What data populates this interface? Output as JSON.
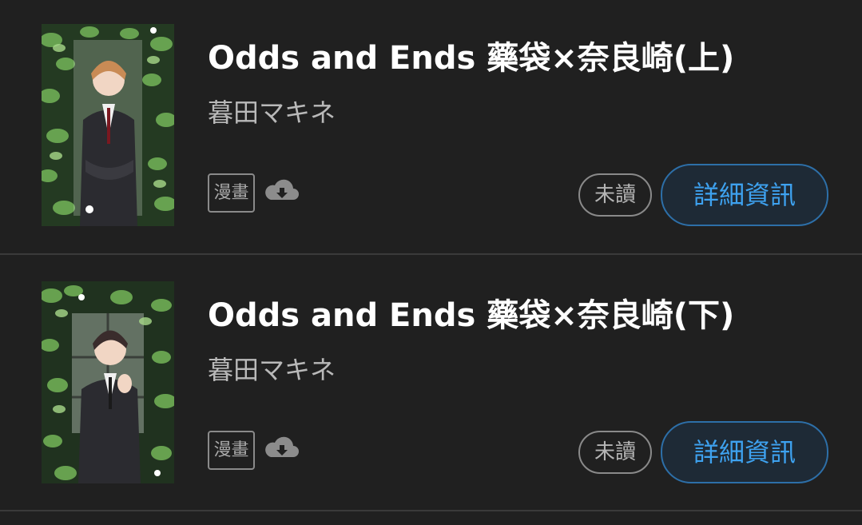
{
  "books": [
    {
      "title": "Odds and Ends 藥袋×奈良崎(上)",
      "author": "暮田マキネ",
      "type_badge": "漫畫",
      "read_status": "未讀",
      "detail_label": "詳細資訊",
      "cover_hair_color": "#c98b55"
    },
    {
      "title": "Odds and Ends 藥袋×奈良崎(下)",
      "author": "暮田マキネ",
      "type_badge": "漫畫",
      "read_status": "未讀",
      "detail_label": "詳細資訊",
      "cover_hair_color": "#3a2c2c"
    }
  ],
  "colors": {
    "background": "#202020",
    "accent": "#3ea2f0",
    "muted": "#b9b9b9"
  },
  "icons": {
    "download": "cloud-download-icon"
  }
}
